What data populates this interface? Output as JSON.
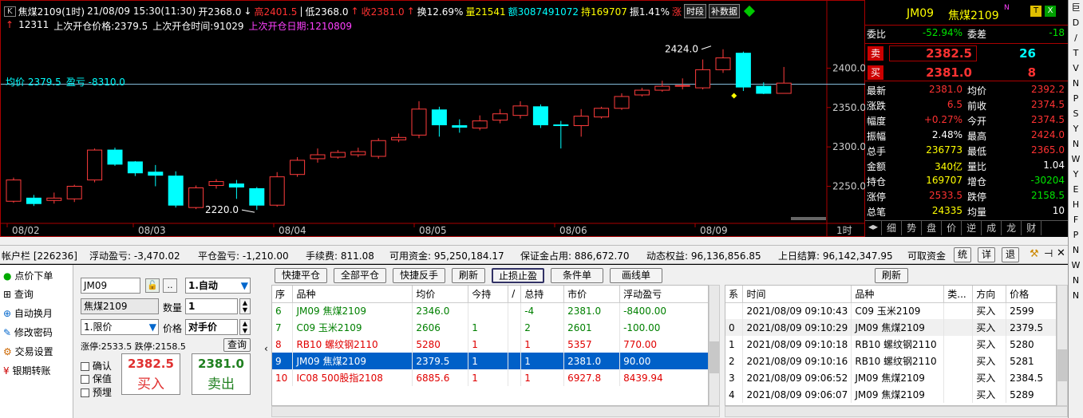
{
  "chart_header": {
    "k_btn": "K",
    "product": "焦煤2109(1时)",
    "datetime": "21/08/09 15:30(11:30)",
    "open_lbl": "开",
    "open": "2368.0",
    "high_lbl": "高",
    "high": "2401.5",
    "low_lbl": "低",
    "low": "2368.0",
    "close_lbl": "收",
    "close": "2381.0",
    "turnover_lbl": "换",
    "turnover": "12.69%",
    "volume_lbl": "量",
    "volume": "21541",
    "amount_lbl": "额",
    "amount": "3087491072",
    "hold_lbl": "持",
    "hold": "169707",
    "amp_lbl": "振",
    "amp": "1.41%",
    "up_lbl": "涨",
    "period_btn": "时段",
    "fill_btn": "补数据"
  },
  "chart_info": {
    "count": "12311",
    "last_price_lbl": "上次开仓价格:2379.5",
    "last_time_lbl": "上次开仓时间:91029",
    "last_date_lbl": "上次开仓日期:1210809",
    "avg_lbl": "均价 2379.5",
    "pnl_lbl": "盈亏 -8310.0"
  },
  "chart_data": {
    "type": "candlestick",
    "x_labels": [
      "08/02",
      "08/03",
      "08/04",
      "08/05",
      "08/06",
      "08/09"
    ],
    "period_label": "1时",
    "y_ticks": [
      "2400.0",
      "2350.0",
      "2300.0",
      "2250.0"
    ],
    "ylim": [
      2210,
      2445
    ],
    "annotations": [
      "2424.0",
      "2220.0"
    ],
    "avg_line": 2379.5,
    "candles": [
      {
        "o": 2231,
        "c": 2258,
        "h": 2261,
        "l": 2229
      },
      {
        "o": 2235,
        "c": 2228,
        "h": 2239,
        "l": 2225
      },
      {
        "o": 2232,
        "c": 2235,
        "h": 2242,
        "l": 2228
      },
      {
        "o": 2234,
        "c": 2250,
        "h": 2252,
        "l": 2230
      },
      {
        "o": 2258,
        "c": 2296,
        "h": 2298,
        "l": 2255
      },
      {
        "o": 2296,
        "c": 2278,
        "h": 2299,
        "l": 2276
      },
      {
        "o": 2281,
        "c": 2267,
        "h": 2282,
        "l": 2263
      },
      {
        "o": 2268,
        "c": 2264,
        "h": 2277,
        "l": 2250
      },
      {
        "o": 2263,
        "c": 2226,
        "h": 2269,
        "l": 2223
      },
      {
        "o": 2223,
        "c": 2248,
        "h": 2251,
        "l": 2221
      },
      {
        "o": 2251,
        "c": 2256,
        "h": 2259,
        "l": 2247
      },
      {
        "o": 2253,
        "c": 2249,
        "h": 2258,
        "l": 2234
      },
      {
        "o": 2247,
        "c": 2226,
        "h": 2249,
        "l": 2220
      },
      {
        "o": 2226,
        "c": 2262,
        "h": 2268,
        "l": 2224
      },
      {
        "o": 2265,
        "c": 2283,
        "h": 2287,
        "l": 2262
      },
      {
        "o": 2285,
        "c": 2290,
        "h": 2298,
        "l": 2280
      },
      {
        "o": 2287,
        "c": 2293,
        "h": 2296,
        "l": 2285
      },
      {
        "o": 2290,
        "c": 2294,
        "h": 2299,
        "l": 2287
      },
      {
        "o": 2288,
        "c": 2308,
        "h": 2311,
        "l": 2285
      },
      {
        "o": 2309,
        "c": 2312,
        "h": 2317,
        "l": 2306
      },
      {
        "o": 2315,
        "c": 2348,
        "h": 2358,
        "l": 2311
      },
      {
        "o": 2347,
        "c": 2328,
        "h": 2351,
        "l": 2313
      },
      {
        "o": 2327,
        "c": 2325,
        "h": 2335,
        "l": 2318
      },
      {
        "o": 2324,
        "c": 2333,
        "h": 2340,
        "l": 2321
      },
      {
        "o": 2334,
        "c": 2342,
        "h": 2348,
        "l": 2330
      },
      {
        "o": 2340,
        "c": 2352,
        "h": 2358,
        "l": 2336
      },
      {
        "o": 2351,
        "c": 2328,
        "h": 2354,
        "l": 2324
      },
      {
        "o": 2328,
        "c": 2327,
        "h": 2333,
        "l": 2298
      },
      {
        "o": 2327,
        "c": 2339,
        "h": 2348,
        "l": 2313
      },
      {
        "o": 2338,
        "c": 2349,
        "h": 2351,
        "l": 2336
      },
      {
        "o": 2349,
        "c": 2364,
        "h": 2368,
        "l": 2347
      },
      {
        "o": 2366,
        "c": 2372,
        "h": 2375,
        "l": 2364
      },
      {
        "o": 2372,
        "c": 2377,
        "h": 2384,
        "l": 2370
      },
      {
        "o": 2377,
        "c": 2378,
        "h": 2387,
        "l": 2373
      },
      {
        "o": 2375,
        "c": 2398,
        "h": 2411,
        "l": 2373
      },
      {
        "o": 2398,
        "c": 2413,
        "h": 2424,
        "l": 2394
      },
      {
        "o": 2419,
        "c": 2376,
        "h": 2421,
        "l": 2371
      },
      {
        "o": 2377,
        "c": 2368,
        "h": 2382,
        "l": 2367
      },
      {
        "o": 2368,
        "c": 2381,
        "h": 2401.5,
        "l": 2368
      }
    ]
  },
  "quote": {
    "code": "JM09",
    "name": "焦煤2109",
    "nflag": "N",
    "t_btn": "T",
    "x_btn": "X",
    "webi_lbl": "委比",
    "webi": "-52.94%",
    "wecha_lbl": "委差",
    "wecha": "-18",
    "sell_lbl": "卖",
    "sell_px": "2382.5",
    "sell_vol": "26",
    "buy_lbl": "买",
    "buy_px": "2381.0",
    "buy_vol": "8",
    "rows": [
      {
        "l1": "最新",
        "v1": "2381.0",
        "l2": "均价",
        "v2": "2392.2"
      },
      {
        "l1": "涨跌",
        "v1": "6.5",
        "l2": "前收",
        "v2": "2374.5"
      },
      {
        "l1": "幅度",
        "v1": "+0.27%",
        "l2": "今开",
        "v2": "2374.5"
      },
      {
        "l1": "振幅",
        "v1": "2.48%",
        "l2": "最高",
        "v2": "2424.0"
      },
      {
        "l1": "总手",
        "v1": "236773",
        "l2": "最低",
        "v2": "2365.0"
      },
      {
        "l1": "金额",
        "v1": "340亿",
        "l2": "量比",
        "v2": "1.04"
      },
      {
        "l1": "持仓",
        "v1": "169707",
        "l2": "增仓",
        "v2": "-30204"
      },
      {
        "l1": "涨停",
        "v1": "2533.5",
        "l2": "跌停",
        "v2": "2158.5"
      },
      {
        "l1": "总笔",
        "v1": "24335",
        "l2": "均量",
        "v2": "10"
      }
    ],
    "tabs": [
      "细",
      "势",
      "盘",
      "价",
      "逆",
      "成",
      "龙",
      "财"
    ]
  },
  "right_strip": [
    "巨",
    "D",
    "/",
    "T",
    "V",
    "N",
    "P",
    "S",
    "Y",
    "N",
    "W",
    "Y",
    "E",
    "H",
    "F",
    "P",
    "N",
    "W",
    "N",
    "N"
  ],
  "status": {
    "account": "帐户栏 [226236]",
    "float_pnl": "浮动盈亏: -3,470.02",
    "close_pnl": "平仓盈亏: -1,210.00",
    "fee": "手续费: 811.08",
    "available": "可用资金: 95,250,184.17",
    "margin": "保证金占用: 886,672.70",
    "equity": "动态权益: 96,136,856.85",
    "last_settle": "上日结算: 96,142,347.95",
    "withdrawable": "可取资金",
    "btn_tie": "统",
    "btn_detail": "详",
    "btn_back": "退"
  },
  "left_menu": [
    "点价下单",
    "查询",
    "自动换月",
    "修改密码",
    "交易设置",
    "银期转账"
  ],
  "order": {
    "code": "JM09",
    "name": "焦煤2109",
    "mode": "1.自动",
    "qty_lbl": "数量",
    "qty": "1",
    "type": "1.限价",
    "price_lbl": "价格",
    "price": "对手价",
    "limits": "涨停:2533.5 跌停:2158.5",
    "query_btn": "查询",
    "confirm": "确认",
    "keep": "保值",
    "pre": "预埋",
    "buy_px": "2382.5",
    "buy_lbl": "买入",
    "sell_px": "2381.0",
    "sell_lbl": "卖出"
  },
  "pos_toolbar": [
    "快捷平仓",
    "全部平仓",
    "快捷反手",
    "刷新",
    "止损止盈",
    "条件单",
    "画线单"
  ],
  "positions": {
    "headers": [
      "序",
      "品种",
      "均价",
      "今持",
      "/",
      "总持",
      "市价",
      "浮动盈亏"
    ],
    "rows": [
      {
        "seq": "6",
        "name": "JM09 焦煤2109",
        "avg": "2346.0",
        "today": "",
        "total": "-4",
        "mkt": "2381.0",
        "pnl": "-8400.00",
        "color": "green"
      },
      {
        "seq": "7",
        "name": "C09 玉米2109",
        "avg": "2606",
        "today": "1",
        "total": "2",
        "mkt": "2601",
        "pnl": "-100.00",
        "color": "green"
      },
      {
        "seq": "8",
        "name": "RB10 螺纹钢2110",
        "avg": "5280",
        "today": "1",
        "total": "1",
        "mkt": "5357",
        "pnl": "770.00",
        "color": "red"
      },
      {
        "seq": "9",
        "name": "JM09 焦煤2109",
        "avg": "2379.5",
        "today": "1",
        "total": "1",
        "mkt": "2381.0",
        "pnl": "90.00",
        "color": "sel"
      },
      {
        "seq": "10",
        "name": "IC08 500股指2108",
        "avg": "6885.6",
        "today": "1",
        "total": "1",
        "mkt": "6927.8",
        "pnl": "8439.94",
        "color": "red"
      }
    ]
  },
  "trade_refresh": "刷新",
  "trades": {
    "headers": [
      "系",
      "时间",
      "品种",
      "类...",
      "方向",
      "价格"
    ],
    "rows": [
      {
        "k": "",
        "time": "2021/08/09 09:10:43",
        "name": "C09 玉米2109",
        "kind": "",
        "dir": "买入",
        "px": "2599"
      },
      {
        "k": "0",
        "time": "2021/08/09 09:10:29",
        "name": "JM09 焦煤2109",
        "kind": "",
        "dir": "买入",
        "px": "2379.5"
      },
      {
        "k": "1",
        "time": "2021/08/09 09:10:18",
        "name": "RB10 螺纹钢2110",
        "kind": "",
        "dir": "买入",
        "px": "5280"
      },
      {
        "k": "2",
        "time": "2021/08/09 09:10:16",
        "name": "RB10 螺纹钢2110",
        "kind": "",
        "dir": "买入",
        "px": "5281"
      },
      {
        "k": "3",
        "time": "2021/08/09 09:06:52",
        "name": "JM09 焦煤2109",
        "kind": "",
        "dir": "买入",
        "px": "2384.5"
      },
      {
        "k": "4",
        "time": "2021/08/09 09:06:07",
        "name": "JM09 焦煤2109",
        "kind": "",
        "dir": "买入",
        "px": "5289"
      }
    ]
  }
}
